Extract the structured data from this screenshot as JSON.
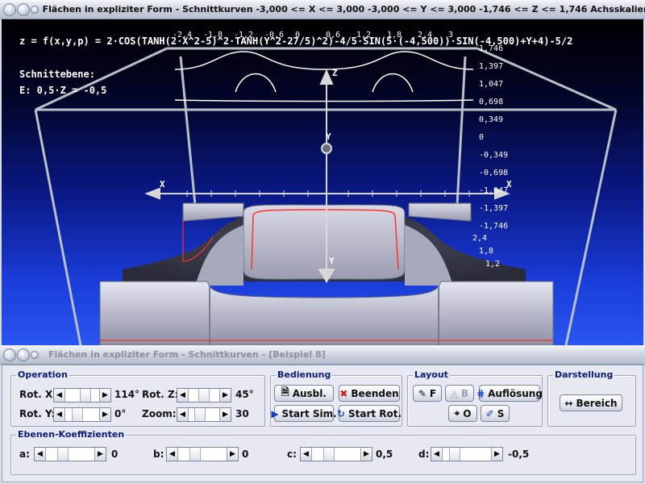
{
  "top_window": {
    "title": "Flächen in expliziter Form - Schnittkurven   -3,000 <= X <= 3,000   -3,000 <= Y <= 3,000   -1,746 <= Z <= 1,746   Achsskalierungseinheiten:  ..."
  },
  "viewport": {
    "formula": "z = f(x,y,p) = 2·COS(TANH(2·X^2-5)^2·TANH(Y^2-27/5)^2)-4/5·SIN(5·(-4,500))·SIN(-4,500)+Y+4)-5/2",
    "plane_heading": "Schnittebene:",
    "plane_equation": "E: 0,5·Z = -0,5",
    "axis_labels": {
      "z": "Z",
      "y_top": "Y",
      "x_left": "X",
      "x_right": "X",
      "y_bottom": "Y"
    },
    "z_ticks": [
      "1,746",
      "1,397",
      "1,047",
      "0,698",
      "0,349",
      "0",
      "-0,349",
      "-0,698",
      "-1,047",
      "-1,397",
      "-1,746"
    ],
    "y_ticks": [
      "2,4",
      "1,8",
      "1,2"
    ],
    "top_ticks": [
      "-2,4",
      "-1,8",
      "-1,2",
      "-0,6",
      "0",
      "0,6",
      "1,2",
      "1,8",
      "2,4",
      "3"
    ]
  },
  "bottom_window": {
    "title": "Flächen in expliziter Form - Schnittkurven - [Beispiel 8]"
  },
  "operation": {
    "title": "Operation",
    "rot_x": {
      "label": "Rot. X:",
      "value": "114°",
      "pos": 0.63
    },
    "rot_y": {
      "label": "Rot. Y:",
      "value": "0°",
      "pos": 0.3
    },
    "rot_z": {
      "label": "Rot. Z:",
      "value": "45°",
      "pos": 0.5
    },
    "zoom": {
      "label": "Zoom:",
      "value": "30",
      "pos": 0.28
    }
  },
  "bedienung": {
    "title": "Bedienung",
    "ausbl": "Ausbl.",
    "beenden": "Beenden",
    "start_sim": "Start Sim.",
    "start_rot": "Start Rot."
  },
  "layout": {
    "title": "Layout",
    "f": "F",
    "b": "B",
    "aufloesung": "Auflösung",
    "o": "O",
    "s": "S"
  },
  "darstellung": {
    "title": "Darstellung",
    "bereich": "Bereich"
  },
  "ebenen": {
    "title": "Ebenen-Koeffizienten",
    "a": {
      "label": "a:",
      "value": "0",
      "pos": 0.3
    },
    "b": {
      "label": "b:",
      "value": "0",
      "pos": 0.3
    },
    "c": {
      "label": "c:",
      "value": "0,5",
      "pos": 0.3
    },
    "d": {
      "label": "d:",
      "value": "-0,5",
      "pos": 0.18
    }
  },
  "colors": {
    "cut_curve": "#ff3030",
    "surface": "#c4c6d6",
    "axis": "#d8d8d8"
  }
}
